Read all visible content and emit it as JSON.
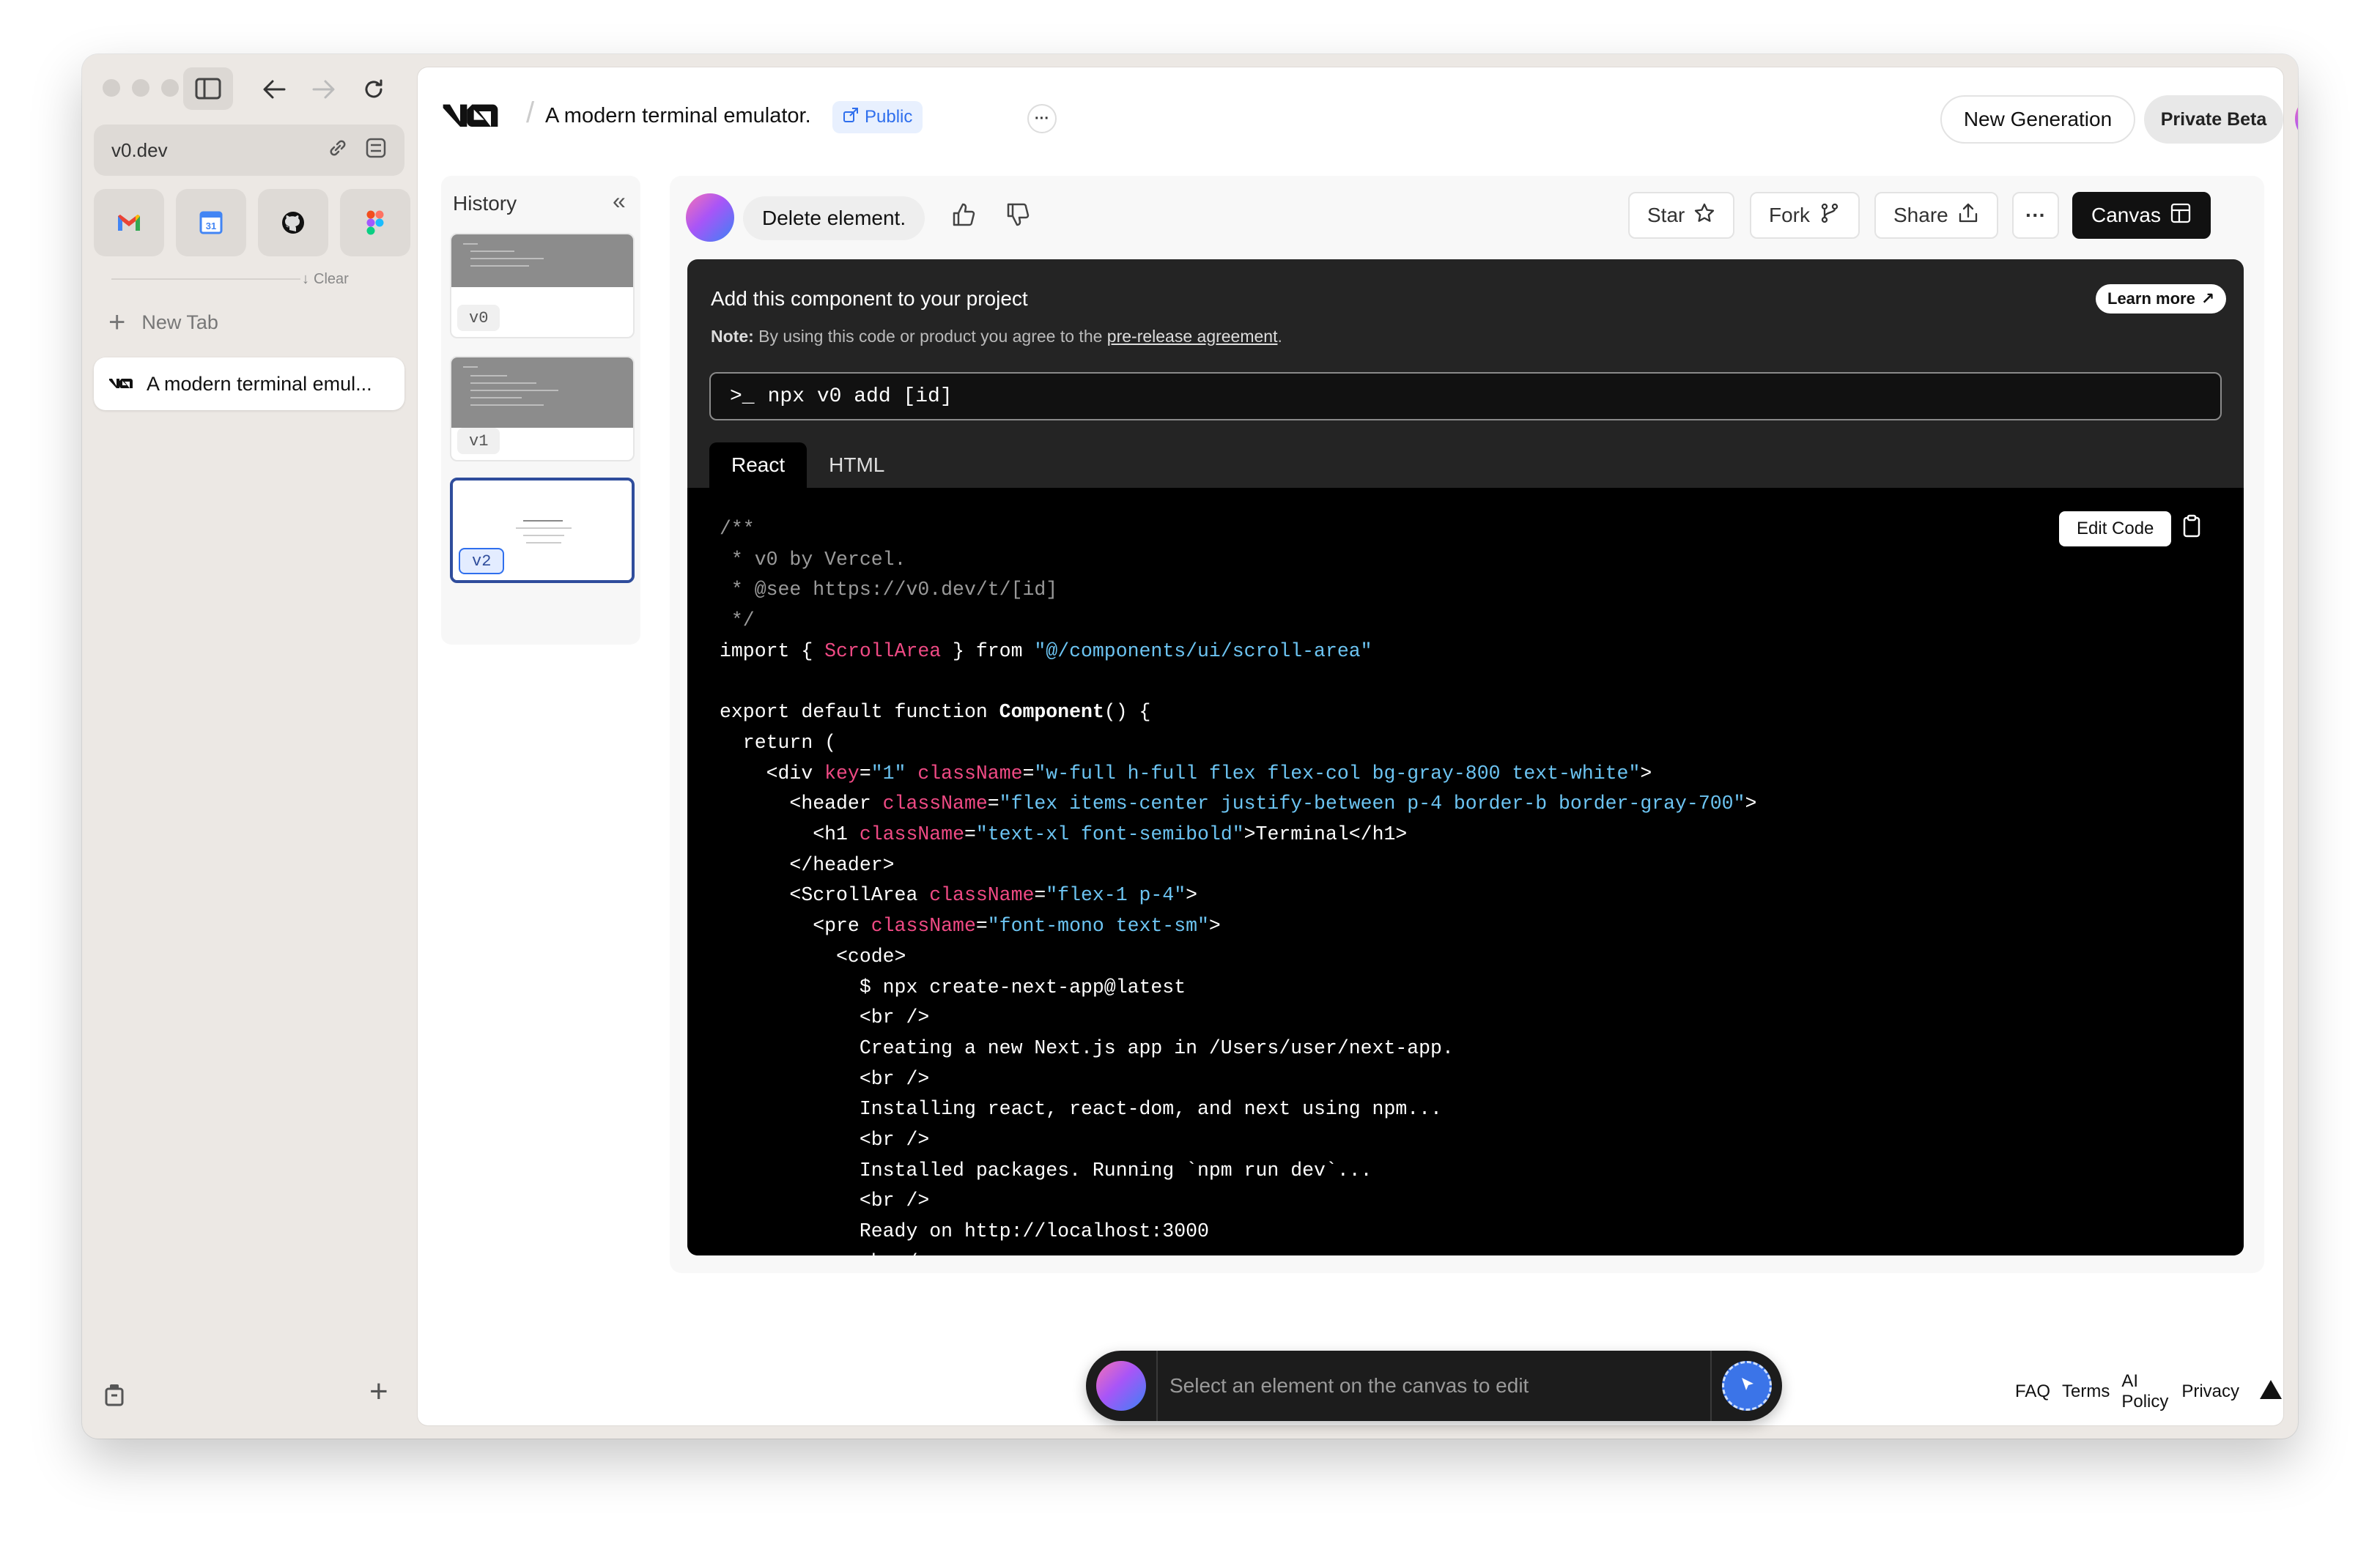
{
  "browser": {
    "url": "v0.dev",
    "clear_label": "Clear",
    "new_tab_label": "New Tab",
    "tabs": [
      {
        "label": "A modern terminal emul..."
      }
    ]
  },
  "header": {
    "project_title": "A modern terminal emulator.",
    "visibility_badge": "Public",
    "more_label": "···",
    "new_generation_label": "New Generation",
    "private_beta_label": "Private Beta"
  },
  "history": {
    "title": "History",
    "versions": [
      {
        "label": "v0"
      },
      {
        "label": "v1"
      },
      {
        "label": "v2"
      }
    ]
  },
  "message": {
    "text": "Delete element."
  },
  "actions": {
    "star_label": "Star",
    "fork_label": "Fork",
    "share_label": "Share",
    "more_label": "···",
    "canvas_label": "Canvas"
  },
  "code_panel": {
    "title": "Add this component to your project",
    "note_prefix": "Note:",
    "note_text": "By using this code or product you agree to the",
    "note_link": "pre-release agreement",
    "note_suffix": ".",
    "learn_more_label": "Learn more",
    "command_prompt": ">_",
    "command": "npx v0 add [id]",
    "tabs": [
      {
        "label": "React"
      },
      {
        "label": "HTML"
      }
    ],
    "edit_code_label": "Edit Code",
    "code_lines": [
      [
        {
          "t": "/**",
          "c": "com"
        }
      ],
      [
        {
          "t": " * v0 by Vercel.",
          "c": "com"
        }
      ],
      [
        {
          "t": " * @see https://v0.dev/t/[id]",
          "c": "com"
        }
      ],
      [
        {
          "t": " */",
          "c": "com"
        }
      ],
      [
        {
          "t": "import { "
        },
        {
          "t": "ScrollArea",
          "c": "pink"
        },
        {
          "t": " } from "
        },
        {
          "t": "\"@/components/ui/scroll-area\"",
          "c": "str"
        }
      ],
      [
        {
          "t": ""
        }
      ],
      [
        {
          "t": "export default function "
        },
        {
          "t": "Component",
          "c": "fn"
        },
        {
          "t": "() {"
        }
      ],
      [
        {
          "t": "  return ("
        }
      ],
      [
        {
          "t": "    <div "
        },
        {
          "t": "key",
          "c": "pink"
        },
        {
          "t": "="
        },
        {
          "t": "\"1\"",
          "c": "str"
        },
        {
          "t": " "
        },
        {
          "t": "className",
          "c": "pink"
        },
        {
          "t": "="
        },
        {
          "t": "\"w-full h-full flex flex-col bg-gray-800 text-white\"",
          "c": "str"
        },
        {
          "t": ">"
        }
      ],
      [
        {
          "t": "      <header "
        },
        {
          "t": "className",
          "c": "pink"
        },
        {
          "t": "="
        },
        {
          "t": "\"flex items-center justify-between p-4 border-b border-gray-700\"",
          "c": "str"
        },
        {
          "t": ">"
        }
      ],
      [
        {
          "t": "        <h1 "
        },
        {
          "t": "className",
          "c": "pink"
        },
        {
          "t": "="
        },
        {
          "t": "\"text-xl font-semibold\"",
          "c": "str"
        },
        {
          "t": ">Terminal</h1>"
        }
      ],
      [
        {
          "t": "      </header>"
        }
      ],
      [
        {
          "t": "      <ScrollArea "
        },
        {
          "t": "className",
          "c": "pink"
        },
        {
          "t": "="
        },
        {
          "t": "\"flex-1 p-4\"",
          "c": "str"
        },
        {
          "t": ">"
        }
      ],
      [
        {
          "t": "        <pre "
        },
        {
          "t": "className",
          "c": "pink"
        },
        {
          "t": "="
        },
        {
          "t": "\"font-mono text-sm\"",
          "c": "str"
        },
        {
          "t": ">"
        }
      ],
      [
        {
          "t": "          <code>"
        }
      ],
      [
        {
          "t": "            $ npx create-next-app@latest"
        }
      ],
      [
        {
          "t": "            <br />"
        }
      ],
      [
        {
          "t": "            Creating a new Next.js app in /Users/user/next-app."
        }
      ],
      [
        {
          "t": "            <br />"
        }
      ],
      [
        {
          "t": "            Installing react, react-dom, and next using npm..."
        }
      ],
      [
        {
          "t": "            <br />"
        }
      ],
      [
        {
          "t": "            Installed packages. Running `npm run dev`..."
        }
      ],
      [
        {
          "t": "            <br />"
        }
      ],
      [
        {
          "t": "            Ready on http://localhost:3000"
        }
      ],
      [
        {
          "t": "            <br />"
        }
      ]
    ]
  },
  "prompt": {
    "placeholder": "Select an element on the canvas to edit"
  },
  "footer": {
    "links": [
      {
        "label": "FAQ"
      },
      {
        "label": "Terms"
      },
      {
        "label": "AI Policy"
      },
      {
        "label": "Privacy"
      }
    ]
  },
  "colors": {
    "accent_blue": "#2f6fed",
    "code_pink": "#ef4a84",
    "code_string": "#6cc4f2",
    "code_comment": "#9a9a9a",
    "dark_button": "#111111"
  }
}
